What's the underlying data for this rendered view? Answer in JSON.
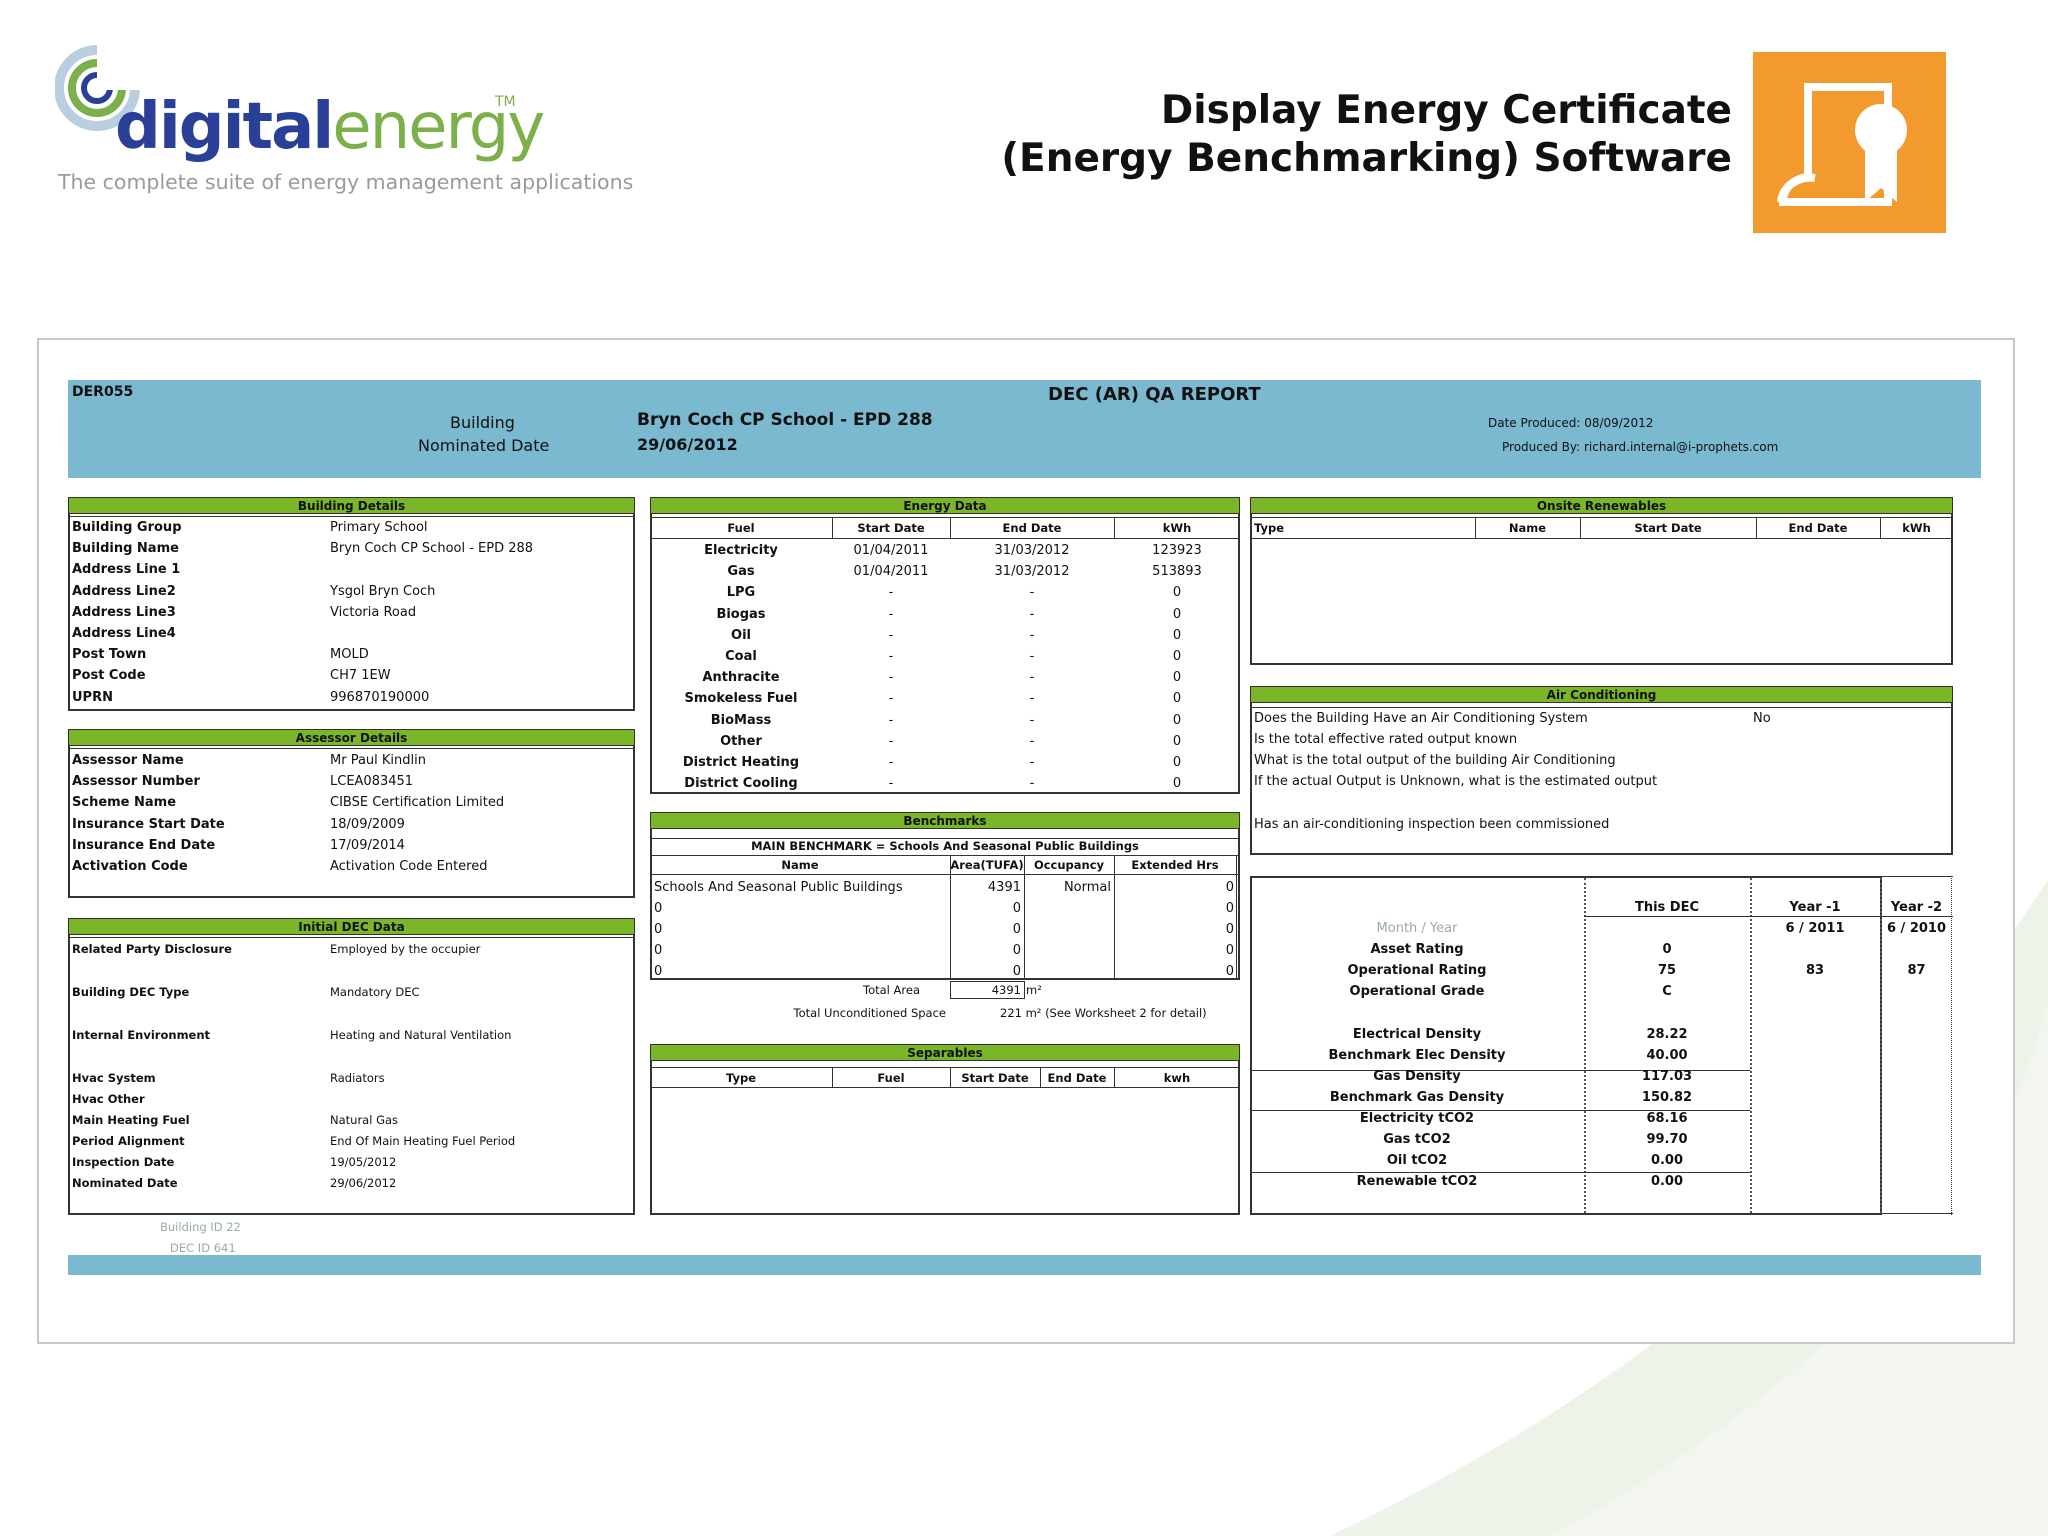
{
  "header": {
    "logo_word_a": "digital",
    "logo_word_b": "energy",
    "logo_tm": "TM",
    "tagline": "The complete suite of energy management applications",
    "title_line1": "Display Energy Certificate",
    "title_line2": "(Energy Benchmarking) Software",
    "icon": "certificate-icon",
    "accent_color": "#f29a2e"
  },
  "report": {
    "code": "DER055",
    "title": "DEC (AR)  QA REPORT",
    "building_label": "Building",
    "nominated_label": "Nominated Date",
    "building_value": "Bryn Coch CP School - EPD 288",
    "nominated_value": "29/06/2012",
    "date_produced": "Date Produced: 08/09/2012",
    "produced_by": "Produced By: richard.internal@i-prophets.com",
    "band_color": "#7ab9d0",
    "bar_color": "#7ab628",
    "footer_line1": "Building ID 22",
    "footer_line2": "DEC ID 641"
  },
  "building_details": {
    "heading": "Building Details",
    "rows": [
      {
        "label": "Building Group",
        "value": "Primary School"
      },
      {
        "label": "Building Name",
        "value": "Bryn Coch CP School - EPD 288"
      },
      {
        "label": "Address Line 1",
        "value": ""
      },
      {
        "label": "Address Line2",
        "value": "Ysgol Bryn Coch"
      },
      {
        "label": "Address Line3",
        "value": "Victoria Road"
      },
      {
        "label": "Address Line4",
        "value": ""
      },
      {
        "label": "Post Town",
        "value": "MOLD"
      },
      {
        "label": "Post Code",
        "value": "CH7 1EW"
      },
      {
        "label": "UPRN",
        "value": "996870190000"
      }
    ]
  },
  "assessor_details": {
    "heading": "Assessor Details",
    "rows": [
      {
        "label": "Assessor Name",
        "value": "Mr Paul Kindlin"
      },
      {
        "label": "Assessor Number",
        "value": "LCEA083451"
      },
      {
        "label": "Scheme Name",
        "value": "CIBSE Certification Limited"
      },
      {
        "label": "Insurance Start Date",
        "value": "18/09/2009"
      },
      {
        "label": "Insurance End Date",
        "value": "17/09/2014"
      },
      {
        "label": "Activation Code",
        "value": "Activation Code Entered"
      }
    ]
  },
  "initial_dec": {
    "heading": "Initial DEC Data",
    "rows": [
      {
        "label": "Related Party Disclosure",
        "value": "Employed by the occupier"
      },
      {
        "label": "Building DEC Type",
        "value": "Mandatory DEC"
      },
      {
        "label": "Internal Environment",
        "value": "Heating and Natural Ventilation"
      },
      {
        "label": "Hvac System",
        "value": "Radiators"
      },
      {
        "label": "Hvac Other",
        "value": ""
      },
      {
        "label": "Main Heating Fuel",
        "value": "Natural Gas"
      },
      {
        "label": "Period Alignment",
        "value": "End Of Main Heating Fuel Period"
      },
      {
        "label": "Inspection Date",
        "value": "19/05/2012"
      },
      {
        "label": "Nominated Date",
        "value": "29/06/2012"
      }
    ]
  },
  "energy_data": {
    "heading": "Energy Data",
    "columns": [
      "Fuel",
      "Start Date",
      "End Date",
      "kWh"
    ],
    "rows": [
      [
        "Electricity",
        "01/04/2011",
        "31/03/2012",
        "123923"
      ],
      [
        "Gas",
        "01/04/2011",
        "31/03/2012",
        "513893"
      ],
      [
        "LPG",
        "-",
        "-",
        "0"
      ],
      [
        "Biogas",
        "-",
        "-",
        "0"
      ],
      [
        "Oil",
        "-",
        "-",
        "0"
      ],
      [
        "Coal",
        "-",
        "-",
        "0"
      ],
      [
        "Anthracite",
        "-",
        "-",
        "0"
      ],
      [
        "Smokeless Fuel",
        "-",
        "-",
        "0"
      ],
      [
        "BioMass",
        "-",
        "-",
        "0"
      ],
      [
        "Other",
        "-",
        "-",
        "0"
      ],
      [
        "District Heating",
        "-",
        "-",
        "0"
      ],
      [
        "District Cooling",
        "-",
        "-",
        "0"
      ]
    ]
  },
  "benchmarks": {
    "heading": "Benchmarks",
    "main": "MAIN BENCHMARK = Schools And Seasonal Public Buildings",
    "columns": [
      "Name",
      "Area(TUFA)",
      "Occupancy",
      "Extended Hrs"
    ],
    "rows": [
      [
        "Schools And Seasonal Public Buildings",
        "4391",
        "Normal",
        "0"
      ],
      [
        "0",
        "0",
        "",
        "0"
      ],
      [
        "0",
        "0",
        "",
        "0"
      ],
      [
        "0",
        "0",
        "",
        "0"
      ],
      [
        "0",
        "0",
        "",
        "0"
      ]
    ],
    "total_area_label": "Total Area",
    "total_area_value": "4391",
    "total_area_unit": "m²",
    "unconditioned_label": "Total Unconditioned Space",
    "unconditioned_value": "221 m²  (See  Worksheet  2  for detail)"
  },
  "separables": {
    "heading": "Separables",
    "columns": [
      "Type",
      "Fuel",
      "Start Date",
      "End Date",
      "kwh"
    ]
  },
  "onsite_renewables": {
    "heading": "Onsite Renewables",
    "columns": [
      "Type",
      "Name",
      "Start Date",
      "End Date",
      "kWh"
    ]
  },
  "air_conditioning": {
    "heading": "Air Conditioning",
    "q1": "Does the Building Have an Air Conditioning System",
    "a1": "No",
    "q2": "Is the total effective rated output known",
    "q3": "What is the total output of the building Air Conditioning",
    "q4": "If the actual Output is Unknown, what is the estimated output",
    "q5": "Has an air-conditioning inspection been commissioned"
  },
  "ratings": {
    "col_this": "This DEC",
    "col_y1": "Year -1",
    "col_y2": "Year -2",
    "month_year_label": "Month / Year",
    "y1_date": "6 / 2011",
    "y2_date": "6 / 2010",
    "rows": [
      {
        "label": "Asset Rating",
        "this": "0",
        "y1": "",
        "y2": ""
      },
      {
        "label": "Operational Rating",
        "this": "75",
        "y1": "83",
        "y2": "87"
      },
      {
        "label": "Operational Grade",
        "this": "C",
        "y1": "",
        "y2": ""
      },
      {
        "label": "Electrical Density",
        "this": "28.22",
        "y1": "",
        "y2": ""
      },
      {
        "label": "Benchmark Elec Density",
        "this": "40.00",
        "y1": "",
        "y2": ""
      },
      {
        "label": "Gas Density",
        "this": "117.03",
        "y1": "",
        "y2": ""
      },
      {
        "label": "Benchmark Gas Density",
        "this": "150.82",
        "y1": "",
        "y2": ""
      },
      {
        "label": "Electricity tCO2",
        "this": "68.16",
        "y1": "",
        "y2": ""
      },
      {
        "label": "Gas tCO2",
        "this": "99.70",
        "y1": "",
        "y2": ""
      },
      {
        "label": "Oil tCO2",
        "this": "0.00",
        "y1": "",
        "y2": ""
      },
      {
        "label": "Renewable tCO2",
        "this": "0.00",
        "y1": "",
        "y2": ""
      }
    ]
  }
}
